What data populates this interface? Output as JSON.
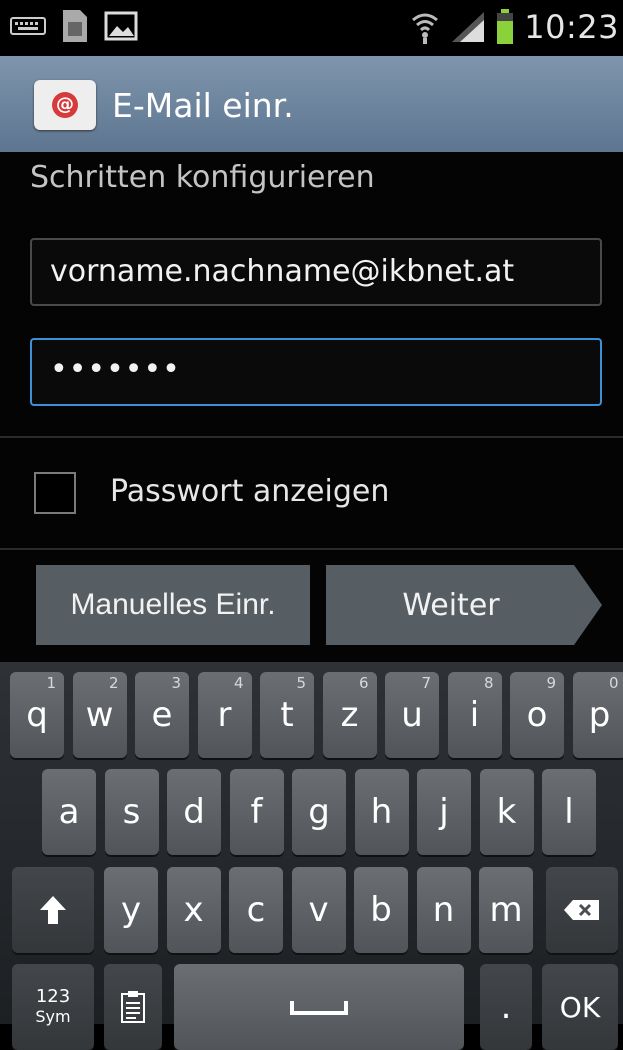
{
  "status_bar": {
    "time": "10:23",
    "icons": [
      "keyboard-icon",
      "sim-card-icon",
      "image-icon",
      "wifi-icon",
      "signal-icon",
      "battery-icon"
    ]
  },
  "action_bar": {
    "title": "E-Mail einr.",
    "app_icon": "email-app-icon"
  },
  "form": {
    "partial_text": "Schritten konfigurieren",
    "email_value": "vorname.nachname@ikbnet.at",
    "password_value": "•••••••",
    "show_password_label": "Passwort anzeigen",
    "show_password_checked": false
  },
  "buttons": {
    "manual": "Manuelles Einr.",
    "next": "Weiter"
  },
  "keyboard": {
    "row1": [
      {
        "k": "q",
        "s": "1"
      },
      {
        "k": "w",
        "s": "2"
      },
      {
        "k": "e",
        "s": "3"
      },
      {
        "k": "r",
        "s": "4"
      },
      {
        "k": "t",
        "s": "5"
      },
      {
        "k": "z",
        "s": "6"
      },
      {
        "k": "u",
        "s": "7"
      },
      {
        "k": "i",
        "s": "8"
      },
      {
        "k": "o",
        "s": "9"
      },
      {
        "k": "p",
        "s": "0"
      }
    ],
    "row2": [
      "a",
      "s",
      "d",
      "f",
      "g",
      "h",
      "j",
      "k",
      "l"
    ],
    "row3": [
      "y",
      "x",
      "c",
      "v",
      "b",
      "n",
      "m"
    ],
    "sym_top": "123",
    "sym_bottom": "Sym",
    "period": ".",
    "ok": "OK"
  },
  "colors": {
    "action_bar": "#6f86a0",
    "focus_border": "#3d8fd6",
    "button_bg": "#575e63",
    "key_bg": "#5e6266"
  }
}
